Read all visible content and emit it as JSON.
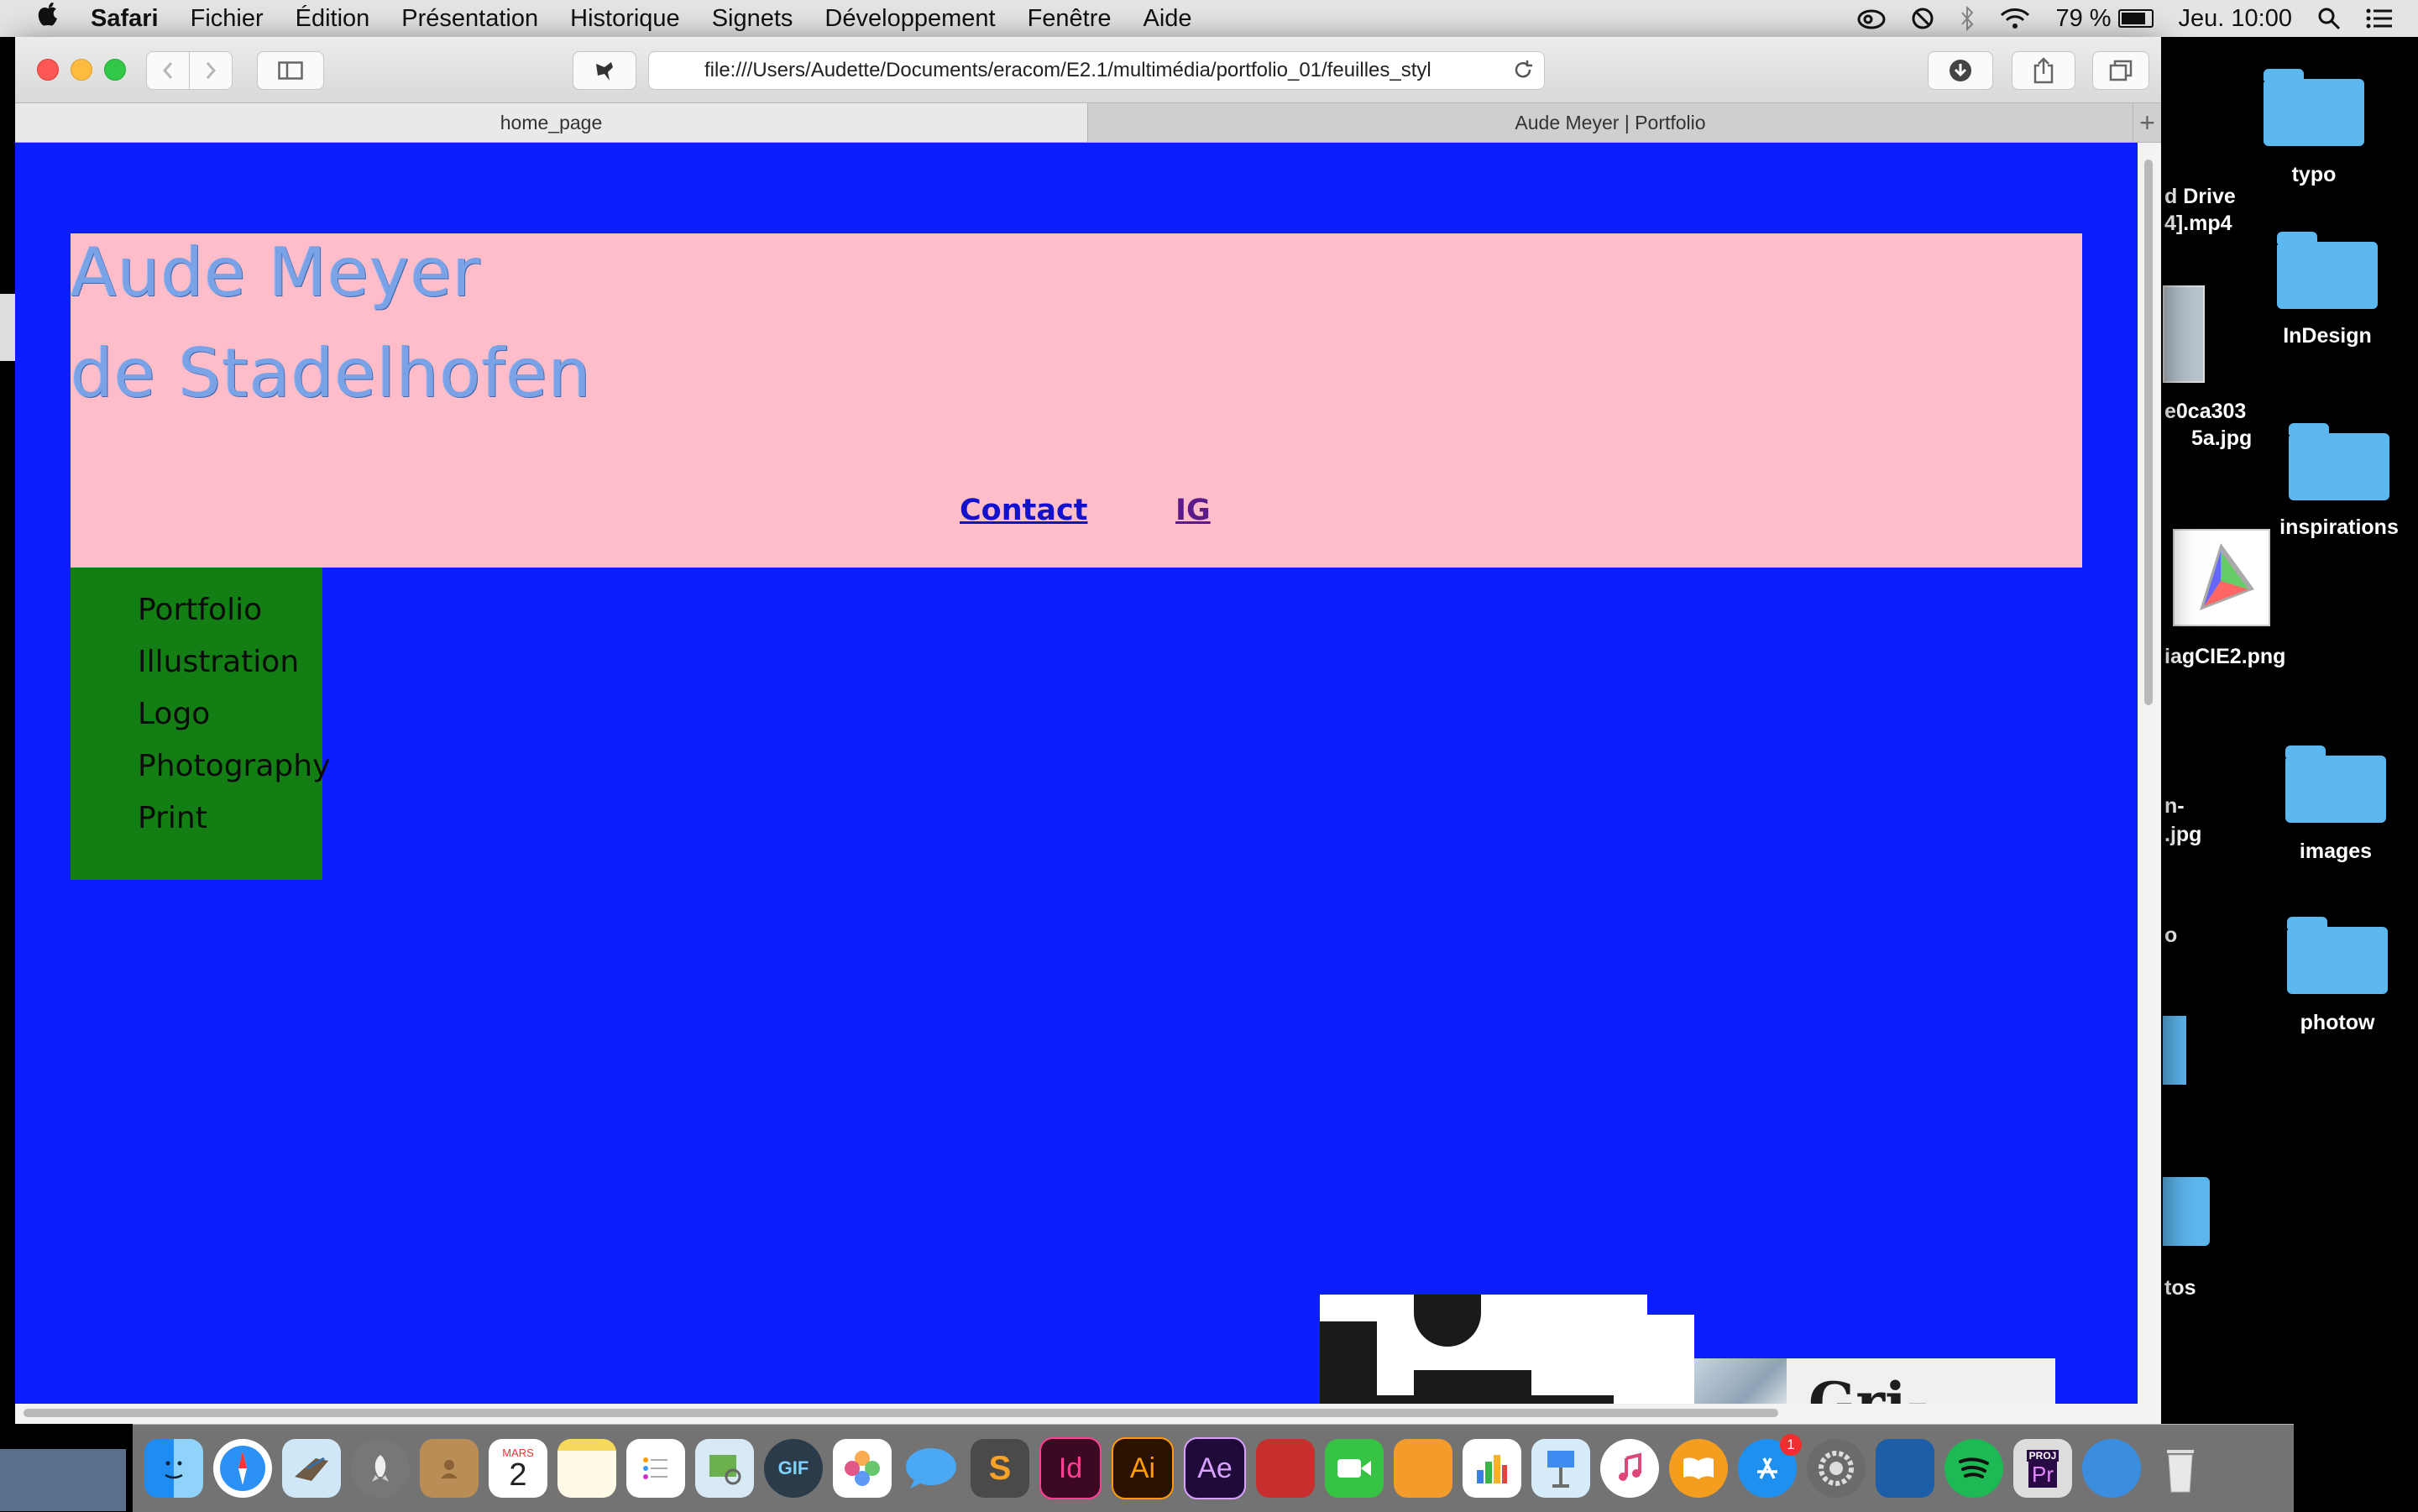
{
  "menubar": {
    "app_name": "Safari",
    "items": [
      "Fichier",
      "Édition",
      "Présentation",
      "Historique",
      "Signets",
      "Développement",
      "Fenêtre",
      "Aide"
    ],
    "battery": "79 %",
    "clock": "Jeu. 10:00"
  },
  "browser": {
    "url": "file:///Users/Audette/Documents/eracom/E2.1/multimédia/portfolio_01/feuilles_styl",
    "tabs": [
      {
        "label": "home_page",
        "active": true
      },
      {
        "label": "Aude Meyer | Portfolio",
        "active": false
      }
    ],
    "new_tab": "+"
  },
  "page": {
    "colors": {
      "background": "#0b1efb",
      "header": "#ffbdca",
      "sidebar": "#137e13"
    },
    "title_line1": "Aude Meyer",
    "title_line2": "de Stadelhofen",
    "links": {
      "contact": "Contact",
      "ig": "IG"
    },
    "sidebar_items": [
      "Portfolio",
      "Illustration",
      "Logo",
      "Photography",
      "Print"
    ],
    "image_text": "Gri-"
  },
  "desktop": {
    "folders": [
      "typo",
      "InDesign",
      "inspirations",
      "images",
      "photow"
    ],
    "partial_labels": [
      "d Drive",
      "4].mp4",
      "e0ca303",
      "5a.jpg",
      "iagCIE2.png",
      "n-",
      ".jpg",
      "o",
      "tos"
    ]
  },
  "dock": {
    "calendar_month": "MARS",
    "calendar_day": "2",
    "apps": [
      "Finder",
      "Safari",
      "Mail",
      "Launchpad",
      "Contacts",
      "Calendar",
      "Notes",
      "Reminders",
      "Preview",
      "GIF",
      "Photos",
      "Messages",
      "Sublime Text",
      "Id",
      "Ai",
      "Ae",
      "Stuffit",
      "FaceTime",
      "Pages",
      "Numbers",
      "Keynote",
      "iTunes",
      "iBooks",
      "App Store",
      "Preferences",
      "Migration",
      "Spotify",
      "Pr",
      "Globe",
      "Trash"
    ],
    "app_store_badge": "1",
    "proj_label": "PROJ"
  }
}
